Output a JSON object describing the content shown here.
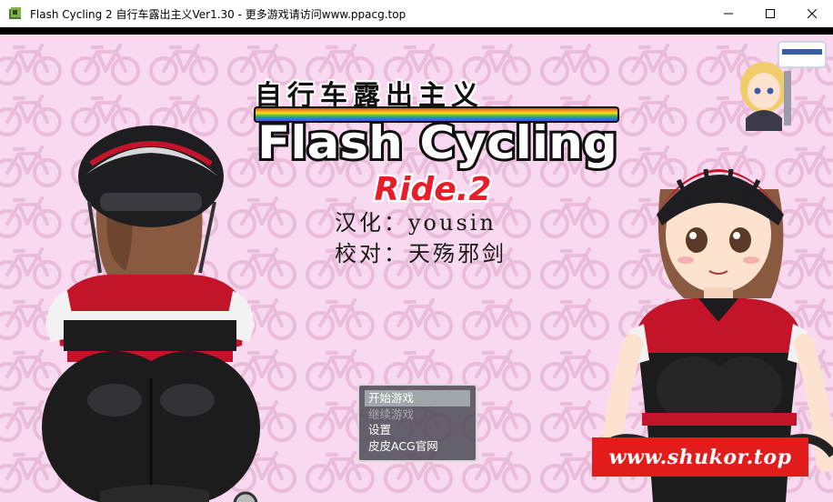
{
  "window": {
    "title": "Flash Cycling 2 自行车露出主义Ver1.30 - 更多游戏请访问www.ppacg.top",
    "app_icon": "game-app-icon",
    "controls": [
      "minimize-icon",
      "maximize-icon",
      "close-icon"
    ]
  },
  "logo": {
    "subtitle": "自行车露出主义",
    "title": "Flash Cycling",
    "ride": "Ride.2"
  },
  "credits": [
    {
      "label": "汉化：",
      "value": "yousin"
    },
    {
      "label": "校对：",
      "value": "天殇邪剑"
    }
  ],
  "menu": {
    "items": [
      {
        "label": "开始游戏",
        "state": "selected"
      },
      {
        "label": "继续游戏",
        "state": "disabled"
      },
      {
        "label": "设置",
        "state": "enabled"
      },
      {
        "label": "皮皮ACG官网",
        "state": "enabled"
      }
    ]
  },
  "watermark": {
    "text": "www.shukor.top"
  },
  "colors": {
    "background": "#f9d9ef",
    "pattern": "#e9bcd9",
    "accent_red": "#c4142a",
    "jersey_black": "#1c1c1c",
    "watermark_red": "#e21b1b"
  }
}
